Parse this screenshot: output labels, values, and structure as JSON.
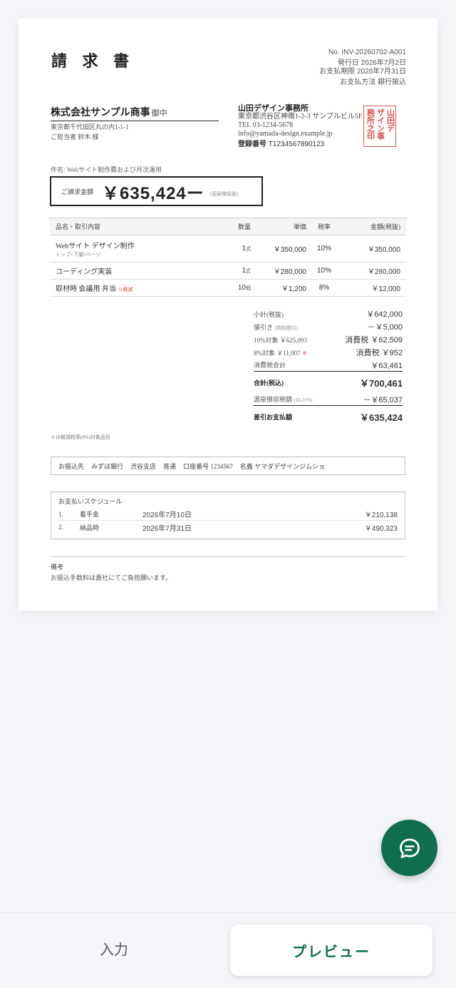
{
  "invoice": {
    "title": "請 求 書",
    "number": "No. INV-20260702-A001",
    "issue_date": "発行日 2026年7月2日",
    "due_date": "お支払期限 2026年7月31日",
    "payment_method": "お支払方法 銀行振込",
    "recipient": {
      "name": "株式会社サンプル商事",
      "honorific": "御中",
      "address": "東京都千代田区丸の内1-1-1",
      "contact": "ご担当者 鈴木 様"
    },
    "issuer": {
      "name": "山田デザイン事務所",
      "address": "東京都渋谷区神南1-2-3 サンプルビル5F",
      "tel": "TEL 03-1234-5678",
      "email": "info@yamada-design.example.jp",
      "reg_label": "登録番号",
      "reg_number": "T1234567890123",
      "seal_lines": [
        "山田デ",
        "ザイン事",
        "務所之印"
      ]
    },
    "subject": "件名: Webサイト制作費および月次運用",
    "total_label": "ご請求金額",
    "total_amount": "￥635,424ー",
    "total_note": "(源泉徴収後)",
    "columns": {
      "name": "品名・取引内容",
      "qty": "数量",
      "unit": "単価",
      "rate": "税率",
      "amount": "金額(税抜)"
    },
    "items": [
      {
        "name": "Webサイト デザイン制作",
        "sub": "トップ+下層5ページ",
        "qty": "1",
        "qty_unit": "式",
        "unit": "￥350,000",
        "rate": "10%",
        "amount": "￥350,000"
      },
      {
        "name": "コーディング実装",
        "qty": "1",
        "qty_unit": "式",
        "unit": "￥280,000",
        "rate": "10%",
        "amount": "￥280,000"
      },
      {
        "name": "取材時 会議用 弁当",
        "mark": "※軽減",
        "qty": "10",
        "qty_unit": "個",
        "unit": "￥1,200",
        "rate": "8%",
        "amount": "￥12,000"
      }
    ],
    "summary": {
      "subtotal_label": "小計(税抜)",
      "subtotal": "￥642,000",
      "discount_label": "値引き",
      "discount_note": "(特別割引)",
      "discount": "－￥5,000",
      "tax10_label": "10%対象 ￥625,093",
      "tax10_name": "消費税",
      "tax10": "￥62,509",
      "tax8_label": "8%対象 ￥11,907",
      "tax8_mark": "※",
      "tax8_name": "消費税",
      "tax8": "￥952",
      "taxsum_label": "消費税合計",
      "taxsum": "￥63,461",
      "total_label": "合計(税込)",
      "total": "￥700,461",
      "withhold_label": "源泉徴収税額",
      "withhold_note": "(10.21%)",
      "withhold": "－￥65,037",
      "net_label": "差引お支払額",
      "net": "￥635,424"
    },
    "footnote": "※は軽減税率(8%)対象品目",
    "bank": {
      "label": "お振込先",
      "bank": "みずほ銀行",
      "branch": "渋谷支店",
      "type": "普通",
      "account": "口座番号 1234567",
      "holder": "名義 ヤマダデザインジムショ"
    },
    "schedule": {
      "title": "お支払いスケジュール",
      "rows": [
        {
          "index": "1.",
          "label": "着手金",
          "date": "2026年7月10日",
          "amount": "￥210,138"
        },
        {
          "index": "2.",
          "label": "納品時",
          "date": "2026年7月31日",
          "amount": "￥490,323"
        }
      ]
    },
    "remarks_title": "備考",
    "remarks_text": "お振込手数料は貴社にてご負担願います。"
  },
  "nav": {
    "input_tab": "入力",
    "preview_tab": "プレビュー"
  },
  "colors": {
    "accent": "#0f6e4e",
    "seal": "#d9534f"
  }
}
